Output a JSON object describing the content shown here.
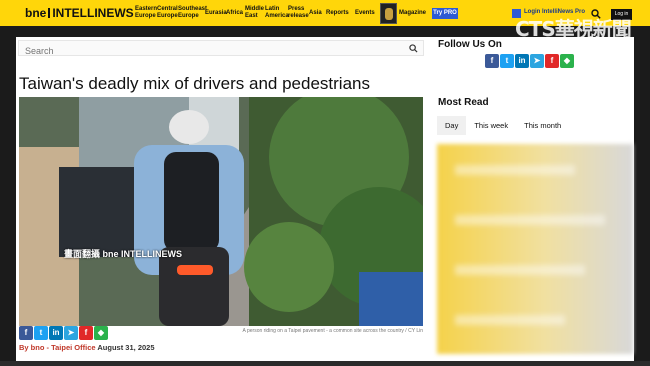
{
  "nav": {
    "logo_left": "bne",
    "logo_right": "INTELLINEWS",
    "items": [
      {
        "line1": "Eastern",
        "line2": "Europe"
      },
      {
        "line1": "Central",
        "line2": "Europe"
      },
      {
        "line1": "Southeast",
        "line2": "Europe"
      },
      {
        "line1": "Eurasia",
        "line2": ""
      },
      {
        "line1": "Africa",
        "line2": ""
      },
      {
        "line1": "Middle",
        "line2": "East"
      },
      {
        "line1": "Latin",
        "line2": "America"
      },
      {
        "line1": "Press",
        "line2": "release"
      },
      {
        "line1": "Asia",
        "line2": ""
      },
      {
        "line1": "Reports",
        "line2": ""
      },
      {
        "line1": "Events",
        "line2": ""
      },
      {
        "line1": "Magazine",
        "line2": ""
      }
    ],
    "try_pro": "Try PRO",
    "login_link": "Login IntelliNews Pro",
    "login_button": "Log in"
  },
  "watermark": "CTS華視新聞",
  "search": {
    "placeholder": "Search"
  },
  "article": {
    "title": "Taiwan's deadly mix of drivers and pedestrians",
    "photo_overlay": "畫面翻攝 bne INTELLINEWS",
    "caption": "A person riding on a Taipei pavement - a common site across the country / CY Lin",
    "by": "By bno",
    "office": "Taipei Office",
    "date": "August 31, 2025"
  },
  "share_icons": [
    "facebook-icon",
    "twitter-icon",
    "linkedin-icon",
    "telegram-icon",
    "flipboard-icon",
    "feedly-icon"
  ],
  "sidebar": {
    "follow_title": "Follow Us On",
    "most_read_title": "Most Read",
    "tabs": [
      "Day",
      "This week",
      "This month"
    ]
  },
  "colors": {
    "brand_yellow": "#ffd60a",
    "accent_blue": "#2e5bd4",
    "byline_red": "#c0392b"
  }
}
